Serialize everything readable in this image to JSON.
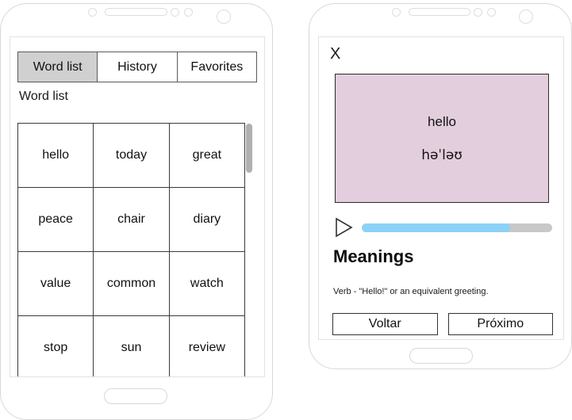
{
  "left_phone": {
    "tabs": [
      {
        "label": "Word list",
        "active": true
      },
      {
        "label": "History",
        "active": false
      },
      {
        "label": "Favorites",
        "active": false
      }
    ],
    "section_title": "Word list",
    "word_grid": {
      "rows": [
        [
          "hello",
          "today",
          "great"
        ],
        [
          "peace",
          "chair",
          "diary"
        ],
        [
          "value",
          "common",
          "watch"
        ],
        [
          "stop",
          "sun",
          "review"
        ]
      ]
    }
  },
  "right_phone": {
    "close_label": "X",
    "card": {
      "word": "hello",
      "ipa": "həˈləʊ",
      "background_color": "#e3cedd"
    },
    "audio": {
      "play_icon": "play-triangle-icon",
      "progress_percent": 78,
      "fill_color": "#8cd2f7",
      "track_color": "#c8c8c8"
    },
    "meanings_heading": "Meanings",
    "meaning_text": "Verb - \"Hello!\" or an equivalent greeting.",
    "buttons": [
      {
        "label": "Voltar"
      },
      {
        "label": "Próximo"
      }
    ]
  }
}
